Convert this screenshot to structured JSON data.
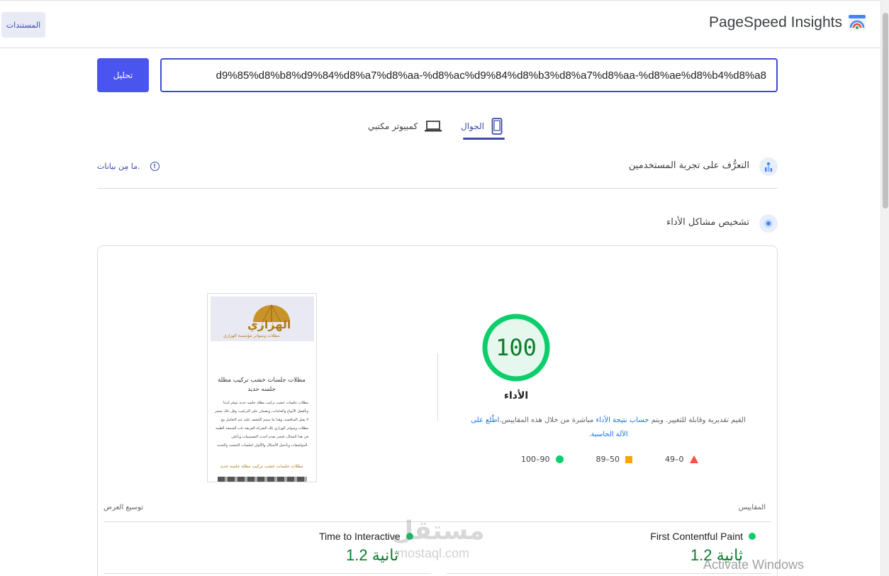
{
  "header": {
    "brand": "PageSpeed Insights",
    "docs_button": "المستندات"
  },
  "url_bar": {
    "value": "‫d9%85%d8%b8%d9%84%d8%a7%d8%aa-%d8%ac%d9%84%d8%b3%d8%a7%d8%aa-%d8%ae%d8%b4%d8%a8",
    "analyze_button": "تحليل"
  },
  "tabs": {
    "mobile": "الجوال",
    "desktop": "كمبيوتر مكتبي",
    "active": "mobile"
  },
  "field_data": {
    "title": "التعرُّف على تجربة المستخدمين",
    "no_data": "ما مِن بيانات."
  },
  "diagnostics": {
    "title": "تشخيص مشاكل الأداء"
  },
  "performance": {
    "score": "100",
    "label": "الأداء",
    "desc_text": "القيم تقديرية وقابلة للتغيير. ويتم ",
    "desc_link1": "حساب نتيجة الأداء",
    "desc_mid": " مباشرة من خلال هذه المقاييس.",
    "desc_link2": "اطّلع على الآلة الحاسبة.",
    "legend": {
      "good": "100–90",
      "average": "89–50",
      "poor": "49–0"
    },
    "colors": {
      "good": "#0cce6b",
      "average": "#ffa400",
      "poor": "#ff4e42"
    }
  },
  "thumbnail": {
    "logo_text": "الهزازي",
    "logo_sub": "مظلات وسواتر مؤسسة الهزازي",
    "title": "مظلات جلسات خشب تركيب مظلة جلسه حديد",
    "body": "مظلات جلسات خشب تركيب مظلة جلسه حديد تتوفر لدينا وبأفضل الأنواع والخامات، وبضمان على التركيب، وقل ذلك بسعر لا يقبل المنافسة، وهذا ما سيتم الكشف عليه عند التعامل مع مظلات وسواتر الهزازي تلك الشركة العريقة ذات السمعة الطيبة في هذا المجال، فنحن نقدم أحدث التصميمات وبأعلى المواصفات وبأجمل الأشكال والألوان لجلسات الخشب والحديد.",
    "link": "مظلات جلسات خشب تركيب مظلة جلسه حديد"
  },
  "metrics": {
    "label": "المقاييس",
    "expand": "توسيع العرض",
    "items": [
      {
        "name": "First Contentful Paint",
        "value": "1.2 ثانية"
      },
      {
        "name": "Time to Interactive",
        "value": "1.2 ثانية"
      }
    ]
  },
  "watermarks": {
    "site_ar": "مستقل",
    "site_en": "mostaql.com",
    "os": "Activate Windows"
  }
}
